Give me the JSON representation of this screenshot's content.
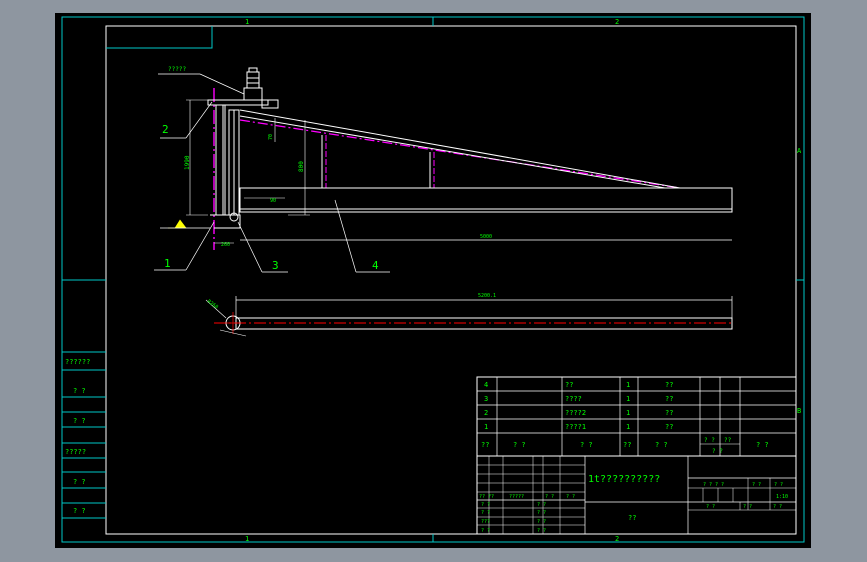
{
  "colors": {
    "background": "#8e96a0",
    "sheet": "#000000",
    "frame": "#00c8c8",
    "structure": "#ffffff",
    "label": "#00ff00",
    "dimension": "#00ff00",
    "centerline_magenta": "#ff00ff",
    "centerline_red": "#ff0000",
    "accent_yellow": "#ffff00"
  },
  "zone_marks": {
    "top_left": "1",
    "top_right": "2",
    "bottom_left": "1",
    "bottom_right": "2",
    "right_a": "A",
    "right_b": "B"
  },
  "callouts": {
    "c1": "1",
    "c2": "2",
    "c3": "3",
    "c4": "4",
    "motor_note": "?????"
  },
  "dimensions": {
    "d_height_left": "1990",
    "d_height_right": "800",
    "d_small_top": "70",
    "d_small_mid": "90",
    "d_base": "260",
    "d_span": "5000",
    "d_plan": "5200.1",
    "d_radius": "R260"
  },
  "left_block": {
    "r1": "??????",
    "r2": "? ?",
    "r3": "? ?",
    "r4": "?????",
    "r5": "? ?",
    "r6": "? ?"
  },
  "bom": {
    "rows": [
      {
        "no": "4",
        "name": "??",
        "qty": "1",
        "mat": "??"
      },
      {
        "no": "3",
        "name": "????",
        "qty": "1",
        "mat": "??"
      },
      {
        "no": "2",
        "name": "????2",
        "qty": "1",
        "mat": "??"
      },
      {
        "no": "1",
        "name": "????1",
        "qty": "1",
        "mat": "??"
      }
    ],
    "header": {
      "h_no": "??",
      "h_code": "? ?",
      "h_name": "? ?",
      "h_qty": "??",
      "h_mat": "? ?",
      "h_unit": "? ?",
      "h_total": "??",
      "h_weight": "? ?",
      "h_note": "? ?"
    }
  },
  "title_block": {
    "drawing_title": "1t??????????",
    "company": "??",
    "row_label_a": "?? ??",
    "row_label_b": "?????",
    "row_label_c": "? ?",
    "row_label_d": "? ?",
    "sign_1": "? ?",
    "sign_2": "? ?",
    "sign_3": "? ?",
    "sign_4": "? ?",
    "sign_5": "???",
    "sign_6": "? ?",
    "sign_7": "? ?",
    "sign_8": "? ?",
    "stage_label": "? ? ? ?",
    "weight_label": "? ?",
    "scale_label": "? ?",
    "scale_value": "1:10",
    "sheet_a": "? ?",
    "sheet_b": "? ?",
    "sheet_c": "? ?"
  }
}
